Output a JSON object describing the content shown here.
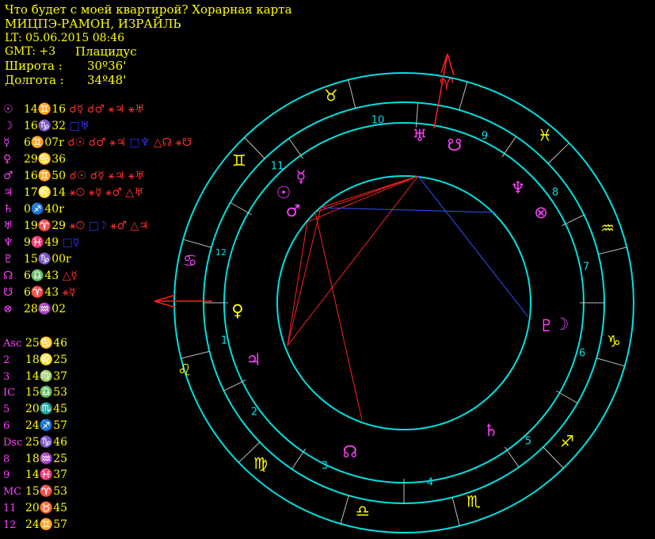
{
  "header": {
    "title": "Что будет с моей квартирой? Хорарная карта",
    "place": "МИЦПЭ-РАМОН, ИЗРАЙЛЬ",
    "lt": "LT: 05.06.2015  08:46",
    "gmt": "GMT: +3",
    "system": "Плацидус",
    "lat_label": "Широта :",
    "lat_value": "30º36'",
    "lon_label": "Долгота :",
    "lon_value": "34º48'"
  },
  "planets": [
    {
      "glyph": "☉",
      "pos": "14♊16",
      "aspects": [
        {
          "t": "☌☿ ☌♂ ⚹♃ ⚹♅",
          "c": "r"
        }
      ]
    },
    {
      "glyph": "☽",
      "pos": "16♑32",
      "aspects": [
        {
          "t": "□♅",
          "c": "s"
        }
      ]
    },
    {
      "glyph": "☿",
      "pos": "6♊07r",
      "aspects": [
        {
          "t": "☌☉ ☌♂ ⚹♃ ",
          "c": "r"
        },
        {
          "t": "□♆ ",
          "c": "s"
        },
        {
          "t": "△☊ ⚹☋",
          "c": "r"
        }
      ]
    },
    {
      "glyph": "♀",
      "pos": "29♋36",
      "aspects": []
    },
    {
      "glyph": "♂",
      "pos": "16♊50",
      "aspects": [
        {
          "t": "☌☉ ☌☿ ⚹♃ ⚹♅",
          "c": "r"
        }
      ]
    },
    {
      "glyph": "♃",
      "pos": "17♌14",
      "aspects": [
        {
          "t": "⚹☉ ⚹☿ ⚹♂ △♅",
          "c": "r"
        }
      ]
    },
    {
      "glyph": "♄",
      "pos": "0♐40r",
      "aspects": []
    },
    {
      "glyph": "♅",
      "pos": "19♈29",
      "aspects": [
        {
          "t": "⚹☉ ",
          "c": "r"
        },
        {
          "t": "□☽ ",
          "c": "s"
        },
        {
          "t": "⚹♂ △♃",
          "c": "r"
        }
      ]
    },
    {
      "glyph": "♆",
      "pos": "9♓49",
      "aspects": [
        {
          "t": "□☿",
          "c": "s"
        }
      ]
    },
    {
      "glyph": "♇",
      "pos": "15♑00r",
      "aspects": []
    },
    {
      "glyph": "☊",
      "pos": "6♎43",
      "aspects": [
        {
          "t": "△☿",
          "c": "r"
        }
      ]
    },
    {
      "glyph": "☋",
      "pos": "6♈43",
      "aspects": [
        {
          "t": "⚹☿",
          "c": "r"
        }
      ]
    },
    {
      "glyph": "⊗",
      "pos": "28♒02",
      "aspects": []
    }
  ],
  "cusps": [
    {
      "n": "Asc",
      "v": "25♋46"
    },
    {
      "n": "2",
      "v": "18♌25"
    },
    {
      "n": "3",
      "v": "14♍37"
    },
    {
      "n": "IC",
      "v": "15♎53"
    },
    {
      "n": "5",
      "v": "20♏45"
    },
    {
      "n": "6",
      "v": "24♐57"
    },
    {
      "n": "Dsc",
      "v": "25♑46"
    },
    {
      "n": "8",
      "v": "18♒25"
    },
    {
      "n": "9",
      "v": "14♓37"
    },
    {
      "n": "MC",
      "v": "15♈53"
    },
    {
      "n": "11",
      "v": "20♉45"
    },
    {
      "n": "12",
      "v": "24♊57"
    }
  ],
  "wheel": {
    "zodiac": [
      "♈",
      "♉",
      "♊",
      "♋",
      "♌",
      "♍",
      "♎",
      "♏",
      "♐",
      "♑",
      "♒",
      "♓"
    ],
    "house_numbers": [
      "1",
      "2",
      "3",
      "4",
      "5",
      "6",
      "7",
      "8",
      "9",
      "10",
      "11",
      "12"
    ],
    "ring_planets": [
      {
        "id": "uranus",
        "g": "♅"
      },
      {
        "id": "south-node",
        "g": "☋"
      },
      {
        "id": "neptune",
        "g": "♆"
      },
      {
        "id": "fortune",
        "g": "⊗"
      },
      {
        "id": "pluto",
        "g": "♇"
      },
      {
        "id": "moon",
        "g": "☽"
      },
      {
        "id": "saturn",
        "g": "♄"
      },
      {
        "id": "north-node",
        "g": "☊"
      },
      {
        "id": "jupiter",
        "g": "♃"
      },
      {
        "id": "venus",
        "g": "♀"
      },
      {
        "id": "mars",
        "g": "♂"
      },
      {
        "id": "sun",
        "g": "☉"
      },
      {
        "id": "mercury",
        "g": "☿"
      }
    ],
    "colors": {
      "ring": "#00e0e0",
      "zodiac": "#ffff00",
      "planet": "#ff40ff",
      "asc_mc": "#ff2020",
      "trine": "#ff2020",
      "square": "#3050ff"
    }
  }
}
